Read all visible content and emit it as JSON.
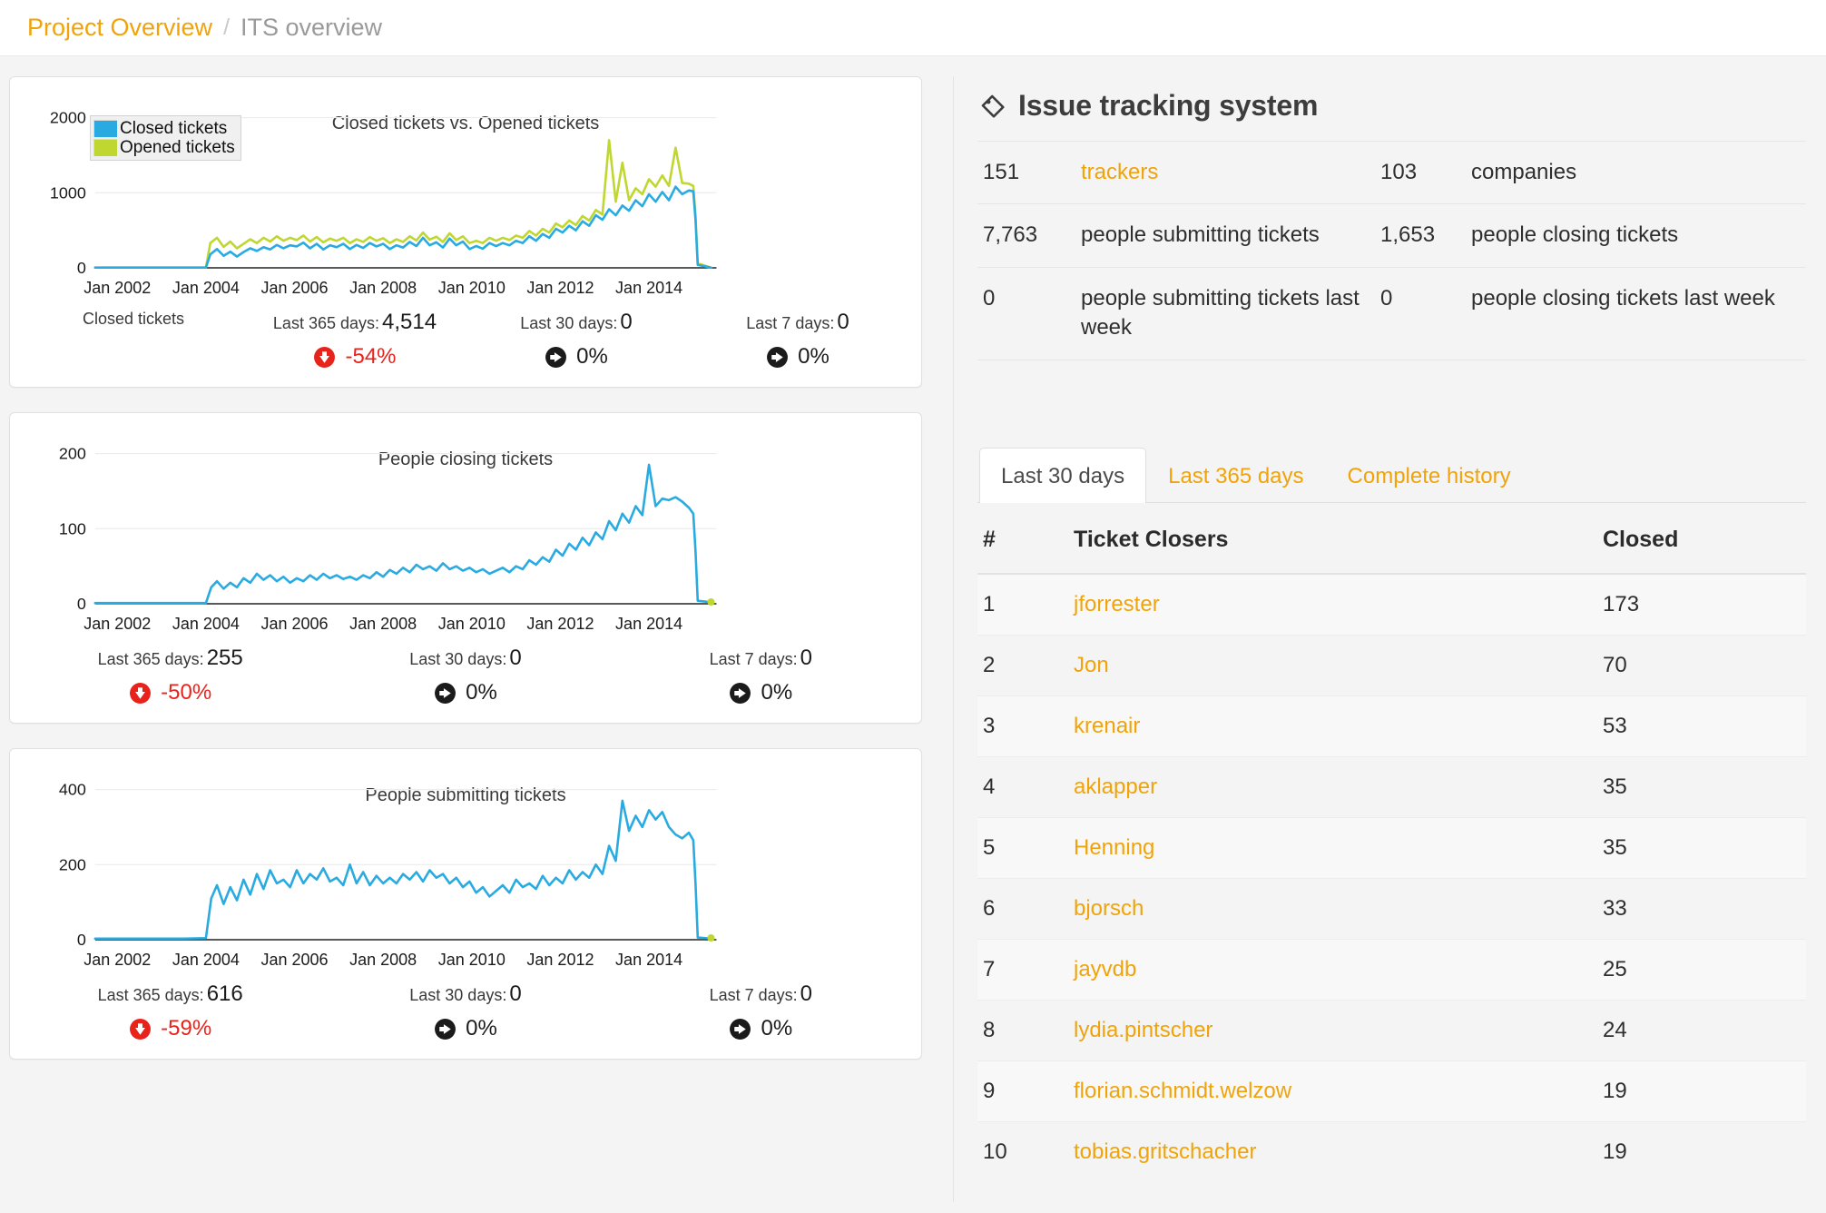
{
  "breadcrumb": {
    "root_label": "Project Overview",
    "separator": "/",
    "current_label": "ITS overview"
  },
  "charts": [
    {
      "title": "Closed tickets vs. Opened tickets",
      "legend": [
        {
          "label": "Closed tickets",
          "color": "#29ABE2"
        },
        {
          "label": "Opened tickets",
          "color": "#BFD730"
        }
      ],
      "series_name": "Closed tickets",
      "stats": [
        {
          "label": "Last 365 days:",
          "value": "4,514",
          "trend_icon": "arrow-down-icon",
          "trend_pct": "-54%",
          "trend_dir": "down"
        },
        {
          "label": "Last 30 days:",
          "value": "0",
          "trend_icon": "arrow-right-icon",
          "trend_pct": "0%",
          "trend_dir": "flat"
        },
        {
          "label": "Last 7 days:",
          "value": "0",
          "trend_icon": "arrow-right-icon",
          "trend_pct": "0%",
          "trend_dir": "flat"
        }
      ]
    },
    {
      "title": "People closing tickets",
      "legend": [],
      "series_name": "",
      "stats": [
        {
          "label": "Last 365 days:",
          "value": "255",
          "trend_icon": "arrow-down-icon",
          "trend_pct": "-50%",
          "trend_dir": "down"
        },
        {
          "label": "Last 30 days:",
          "value": "0",
          "trend_icon": "arrow-right-icon",
          "trend_pct": "0%",
          "trend_dir": "flat"
        },
        {
          "label": "Last 7 days:",
          "value": "0",
          "trend_icon": "arrow-right-icon",
          "trend_pct": "0%",
          "trend_dir": "flat"
        }
      ]
    },
    {
      "title": "People submitting tickets",
      "legend": [],
      "series_name": "",
      "stats": [
        {
          "label": "Last 365 days:",
          "value": "616",
          "trend_icon": "arrow-down-icon",
          "trend_pct": "-59%",
          "trend_dir": "down"
        },
        {
          "label": "Last 30 days:",
          "value": "0",
          "trend_icon": "arrow-right-icon",
          "trend_pct": "0%",
          "trend_dir": "flat"
        },
        {
          "label": "Last 7 days:",
          "value": "0",
          "trend_icon": "arrow-right-icon",
          "trend_pct": "0%",
          "trend_dir": "flat"
        }
      ]
    }
  ],
  "chart_data": [
    {
      "type": "line",
      "title": "Closed tickets vs. Opened tickets",
      "xlabel": "",
      "ylabel": "",
      "ylim": [
        0,
        2200
      ],
      "yticks": [
        0,
        1000,
        2000
      ],
      "ytick_labels": [
        "0",
        "1000",
        "2000"
      ],
      "xticks": [
        "Jan 2002",
        "Jan 2004",
        "Jan 2006",
        "Jan 2008",
        "Jan 2010",
        "Jan 2012",
        "Jan 2014"
      ],
      "xlim_years": [
        2001.5,
        2015.4
      ],
      "grid": true,
      "legend_position": "top-left",
      "series": [
        {
          "name": "Closed tickets",
          "color": "#29ABE2",
          "x": [
            2001.5,
            2002.0,
            2002.5,
            2003.0,
            2003.5,
            2004.0,
            2004.1,
            2004.25,
            2004.4,
            2004.55,
            2004.7,
            2004.85,
            2005.0,
            2005.15,
            2005.3,
            2005.45,
            2005.6,
            2005.75,
            2005.9,
            2006.05,
            2006.2,
            2006.35,
            2006.5,
            2006.65,
            2006.8,
            2006.95,
            2007.1,
            2007.25,
            2007.4,
            2007.55,
            2007.7,
            2007.85,
            2008.0,
            2008.15,
            2008.3,
            2008.45,
            2008.6,
            2008.75,
            2008.9,
            2009.05,
            2009.2,
            2009.35,
            2009.5,
            2009.65,
            2009.8,
            2009.95,
            2010.1,
            2010.25,
            2010.4,
            2010.55,
            2010.7,
            2010.85,
            2011.0,
            2011.15,
            2011.3,
            2011.45,
            2011.6,
            2011.75,
            2011.9,
            2012.05,
            2012.2,
            2012.35,
            2012.5,
            2012.65,
            2012.8,
            2012.95,
            2013.1,
            2013.25,
            2013.4,
            2013.55,
            2013.7,
            2013.85,
            2014.0,
            2014.15,
            2014.3,
            2014.45,
            2014.6,
            2014.75,
            2014.9,
            2015.0,
            2015.05,
            2015.1,
            2015.4
          ],
          "y": [
            3,
            3,
            3,
            3,
            3,
            4,
            180,
            250,
            160,
            215,
            150,
            210,
            260,
            225,
            275,
            245,
            305,
            260,
            300,
            285,
            335,
            260,
            320,
            245,
            300,
            275,
            320,
            250,
            305,
            265,
            330,
            285,
            320,
            250,
            300,
            270,
            345,
            290,
            400,
            300,
            340,
            270,
            390,
            300,
            350,
            250,
            290,
            255,
            330,
            290,
            330,
            300,
            360,
            330,
            420,
            360,
            450,
            400,
            520,
            470,
            560,
            500,
            620,
            560,
            700,
            640,
            780,
            700,
            830,
            760,
            900,
            820,
            980,
            880,
            1010,
            900,
            1080,
            980,
            1030,
            1020,
            640,
            40,
            2
          ]
        },
        {
          "name": "Opened tickets",
          "color": "#BFD730",
          "x": [
            2001.5,
            2002.0,
            2002.5,
            2003.0,
            2003.5,
            2004.0,
            2004.1,
            2004.25,
            2004.4,
            2004.55,
            2004.7,
            2004.85,
            2005.0,
            2005.15,
            2005.3,
            2005.45,
            2005.6,
            2005.75,
            2005.9,
            2006.05,
            2006.2,
            2006.35,
            2006.5,
            2006.65,
            2006.8,
            2006.95,
            2007.1,
            2007.25,
            2007.4,
            2007.55,
            2007.7,
            2007.85,
            2008.0,
            2008.15,
            2008.3,
            2008.45,
            2008.6,
            2008.75,
            2008.9,
            2009.05,
            2009.2,
            2009.35,
            2009.5,
            2009.65,
            2009.8,
            2009.95,
            2010.1,
            2010.25,
            2010.4,
            2010.55,
            2010.7,
            2010.85,
            2011.0,
            2011.15,
            2011.3,
            2011.45,
            2011.6,
            2011.75,
            2011.9,
            2012.05,
            2012.2,
            2012.35,
            2012.5,
            2012.65,
            2012.8,
            2012.95,
            2013.1,
            2013.25,
            2013.4,
            2013.55,
            2013.7,
            2013.85,
            2014.0,
            2014.15,
            2014.3,
            2014.45,
            2014.6,
            2014.75,
            2014.9,
            2015.0,
            2015.05,
            2015.1,
            2015.4
          ],
          "y": [
            5,
            5,
            5,
            5,
            5,
            6,
            330,
            400,
            280,
            350,
            260,
            320,
            380,
            330,
            400,
            350,
            420,
            360,
            400,
            370,
            430,
            350,
            410,
            340,
            390,
            360,
            400,
            330,
            380,
            345,
            410,
            360,
            395,
            330,
            380,
            345,
            420,
            365,
            470,
            375,
            415,
            345,
            460,
            370,
            420,
            330,
            360,
            330,
            400,
            360,
            400,
            370,
            430,
            400,
            490,
            430,
            520,
            470,
            590,
            540,
            630,
            570,
            690,
            630,
            770,
            710,
            1700,
            880,
            1400,
            900,
            1060,
            980,
            1180,
            1080,
            1230,
            1090,
            1600,
            1130,
            1120,
            1090,
            700,
            60,
            3
          ]
        }
      ]
    },
    {
      "type": "line",
      "title": "People closing tickets",
      "xlabel": "",
      "ylabel": "",
      "ylim": [
        0,
        220
      ],
      "yticks": [
        0,
        100,
        200
      ],
      "ytick_labels": [
        "0",
        "100",
        "200"
      ],
      "xticks": [
        "Jan 2002",
        "Jan 2004",
        "Jan 2006",
        "Jan 2008",
        "Jan 2010",
        "Jan 2012",
        "Jan 2014"
      ],
      "xlim_years": [
        2001.5,
        2015.4
      ],
      "grid": true,
      "series": [
        {
          "name": "People closing tickets",
          "color": "#29ABE2",
          "x": [
            2001.5,
            2002.0,
            2002.5,
            2003.0,
            2003.5,
            2004.0,
            2004.12,
            2004.25,
            2004.4,
            2004.55,
            2004.7,
            2004.85,
            2005.0,
            2005.15,
            2005.3,
            2005.45,
            2005.6,
            2005.75,
            2005.9,
            2006.05,
            2006.2,
            2006.35,
            2006.5,
            2006.65,
            2006.8,
            2006.95,
            2007.1,
            2007.25,
            2007.4,
            2007.55,
            2007.7,
            2007.85,
            2008.0,
            2008.15,
            2008.3,
            2008.45,
            2008.6,
            2008.75,
            2008.9,
            2009.05,
            2009.2,
            2009.35,
            2009.5,
            2009.65,
            2009.8,
            2009.95,
            2010.1,
            2010.25,
            2010.4,
            2010.55,
            2010.7,
            2010.85,
            2011.0,
            2011.15,
            2011.3,
            2011.45,
            2011.6,
            2011.75,
            2011.9,
            2012.05,
            2012.2,
            2012.35,
            2012.5,
            2012.65,
            2012.8,
            2012.95,
            2013.1,
            2013.25,
            2013.4,
            2013.55,
            2013.7,
            2013.85,
            2014.0,
            2014.15,
            2014.3,
            2014.45,
            2014.6,
            2014.75,
            2014.9,
            2015.0,
            2015.05,
            2015.1,
            2015.4
          ],
          "y": [
            1,
            1,
            1,
            1,
            1,
            1,
            22,
            30,
            20,
            28,
            22,
            34,
            28,
            40,
            32,
            38,
            30,
            36,
            28,
            34,
            30,
            38,
            32,
            40,
            34,
            38,
            33,
            36,
            32,
            38,
            34,
            42,
            36,
            45,
            40,
            48,
            42,
            52,
            46,
            50,
            44,
            54,
            46,
            50,
            44,
            48,
            42,
            46,
            40,
            44,
            48,
            42,
            50,
            46,
            58,
            52,
            62,
            56,
            72,
            64,
            80,
            72,
            88,
            78,
            95,
            86,
            110,
            98,
            120,
            108,
            130,
            118,
            185,
            130,
            140,
            138,
            142,
            136,
            128,
            120,
            70,
            4,
            2
          ]
        }
      ]
    },
    {
      "type": "line",
      "title": "People submitting tickets",
      "xlabel": "",
      "ylabel": "",
      "ylim": [
        0,
        440
      ],
      "yticks": [
        0,
        200,
        400
      ],
      "ytick_labels": [
        "0",
        "200",
        "400"
      ],
      "xticks": [
        "Jan 2002",
        "Jan 2004",
        "Jan 2006",
        "Jan 2008",
        "Jan 2010",
        "Jan 2012",
        "Jan 2014"
      ],
      "xlim_years": [
        2001.5,
        2015.4
      ],
      "grid": true,
      "series": [
        {
          "name": "People submitting tickets",
          "color": "#29ABE2",
          "x": [
            2001.5,
            2002.0,
            2002.5,
            2003.0,
            2003.5,
            2004.0,
            2004.12,
            2004.25,
            2004.4,
            2004.55,
            2004.7,
            2004.85,
            2005.0,
            2005.15,
            2005.3,
            2005.45,
            2005.6,
            2005.75,
            2005.9,
            2006.05,
            2006.2,
            2006.35,
            2006.5,
            2006.65,
            2006.8,
            2006.95,
            2007.1,
            2007.25,
            2007.4,
            2007.55,
            2007.7,
            2007.85,
            2008.0,
            2008.15,
            2008.3,
            2008.45,
            2008.6,
            2008.75,
            2008.9,
            2009.05,
            2009.2,
            2009.35,
            2009.5,
            2009.65,
            2009.8,
            2009.95,
            2010.1,
            2010.25,
            2010.4,
            2010.55,
            2010.7,
            2010.85,
            2011.0,
            2011.15,
            2011.3,
            2011.45,
            2011.6,
            2011.75,
            2011.9,
            2012.05,
            2012.2,
            2012.35,
            2012.5,
            2012.65,
            2012.8,
            2012.95,
            2013.1,
            2013.25,
            2013.4,
            2013.55,
            2013.7,
            2013.85,
            2014.0,
            2014.15,
            2014.3,
            2014.45,
            2014.6,
            2014.75,
            2014.9,
            2015.0,
            2015.05,
            2015.1,
            2015.4
          ],
          "y": [
            3,
            3,
            3,
            3,
            3,
            4,
            110,
            145,
            95,
            140,
            105,
            160,
            120,
            175,
            135,
            185,
            150,
            160,
            140,
            185,
            150,
            175,
            160,
            190,
            155,
            165,
            145,
            200,
            150,
            180,
            145,
            170,
            150,
            165,
            150,
            175,
            160,
            180,
            155,
            185,
            165,
            175,
            150,
            165,
            140,
            155,
            125,
            140,
            115,
            130,
            145,
            125,
            160,
            140,
            150,
            135,
            170,
            145,
            165,
            150,
            185,
            160,
            180,
            165,
            200,
            175,
            250,
            210,
            370,
            290,
            330,
            300,
            345,
            320,
            340,
            300,
            280,
            270,
            285,
            265,
            150,
            6,
            3
          ]
        }
      ]
    }
  ],
  "its_panel": {
    "icon": "tag-icon",
    "title": "Issue tracking system",
    "stats_rows": [
      {
        "left_value": "151",
        "left_label": "trackers",
        "left_is_link": true,
        "right_value": "103",
        "right_label": "companies",
        "right_is_link": false
      },
      {
        "left_value": "7,763",
        "left_label": "people submitting tickets",
        "left_is_link": false,
        "right_value": "1,653",
        "right_label": "people closing tickets",
        "right_is_link": false
      },
      {
        "left_value": "0",
        "left_label": "people submitting tickets last week",
        "left_is_link": false,
        "right_value": "0",
        "right_label": "people closing tickets last week",
        "right_is_link": false
      }
    ],
    "tabs": [
      {
        "label": "Last 30 days",
        "active": true
      },
      {
        "label": "Last 365 days",
        "active": false
      },
      {
        "label": "Complete history",
        "active": false
      }
    ],
    "table": {
      "headers": {
        "rank": "#",
        "name": "Ticket Closers",
        "closed": "Closed"
      },
      "rows": [
        {
          "rank": "1",
          "name": "jforrester",
          "closed": "173"
        },
        {
          "rank": "2",
          "name": "Jon",
          "closed": "70"
        },
        {
          "rank": "3",
          "name": "krenair",
          "closed": "53"
        },
        {
          "rank": "4",
          "name": "aklapper",
          "closed": "35"
        },
        {
          "rank": "5",
          "name": "Henning",
          "closed": "35"
        },
        {
          "rank": "6",
          "name": "bjorsch",
          "closed": "33"
        },
        {
          "rank": "7",
          "name": "jayvdb",
          "closed": "25"
        },
        {
          "rank": "8",
          "name": "lydia.pintscher",
          "closed": "24"
        },
        {
          "rank": "9",
          "name": "florian.schmidt.welzow",
          "closed": "19"
        },
        {
          "rank": "10",
          "name": "tobias.gritschacher",
          "closed": "19"
        }
      ]
    }
  },
  "colors": {
    "accent": "#f0a30a",
    "closed_series": "#29ABE2",
    "opened_series": "#BFD730",
    "negative": "#e8231c"
  }
}
